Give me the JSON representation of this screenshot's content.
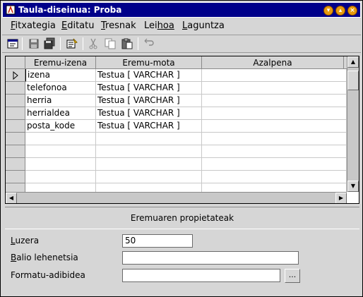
{
  "window": {
    "title": "Taula-diseinua: Proba"
  },
  "menu": [
    {
      "first": "F",
      "rest": "itxategia"
    },
    {
      "first": "E",
      "rest": "ditatu"
    },
    {
      "first": "T",
      "rest": "resnak"
    },
    {
      "first": "Lei",
      "rest": "hoa",
      "underline_index": 1
    },
    {
      "first": "L",
      "rest": "aguntza"
    }
  ],
  "toolbar": {
    "icons": [
      "design-view-icon",
      "save-icon",
      "save-all-icon",
      "properties-icon",
      "cut-icon",
      "copy-icon",
      "paste-icon",
      "undo-icon"
    ]
  },
  "grid": {
    "columns": [
      "Eremu-izena",
      "Eremu-mota",
      "Azalpena"
    ],
    "rows": [
      {
        "name": "izena",
        "type": "Testua [ VARCHAR ]",
        "desc": ""
      },
      {
        "name": "telefonoa",
        "type": "Testua [ VARCHAR ]",
        "desc": ""
      },
      {
        "name": "herria",
        "type": "Testua [ VARCHAR ]",
        "desc": ""
      },
      {
        "name": "herrialdea",
        "type": "Testua [ VARCHAR ]",
        "desc": ""
      },
      {
        "name": "posta_kode",
        "type": "Testua [ VARCHAR ]",
        "desc": ""
      }
    ],
    "empty_rows": 5
  },
  "properties": {
    "title": "Eremuaren propietateak",
    "length_label_first": "L",
    "length_label_rest": "uzera",
    "length_value": "50",
    "default_label_first": "B",
    "default_label_rest": "alio lehenetsia",
    "default_value": "",
    "format_label": "Formatu-adibidea",
    "format_value": "",
    "ellipsis": "..."
  }
}
